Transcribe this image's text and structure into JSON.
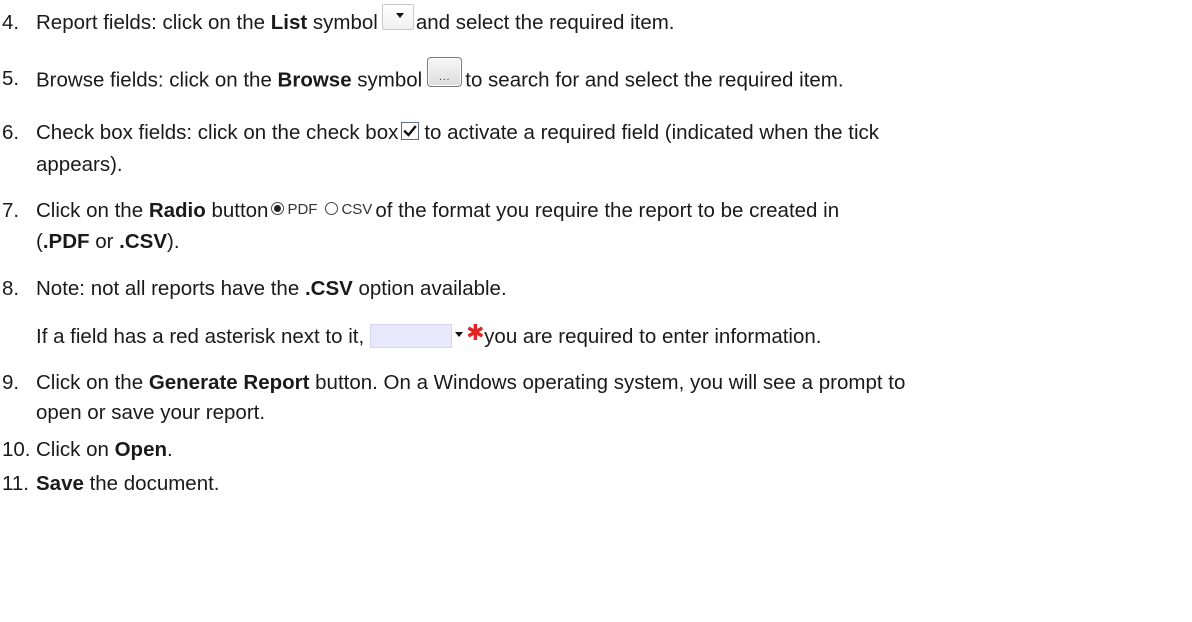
{
  "steps": {
    "s4": {
      "num": "4.",
      "pre": "Report fields: click on the ",
      "bold": "List",
      "mid": " symbol",
      "post": "and select the required item."
    },
    "s5": {
      "num": "5.",
      "pre": "Browse fields: click on the ",
      "bold": "Browse",
      "mid": " symbol",
      "post": "to search for and select the required item.",
      "browse_dots": "..."
    },
    "s6": {
      "num": "6.",
      "pre": "Check box fields: click on the check box",
      "post": "to activate a required field (indicated when the tick",
      "cont": "appears)."
    },
    "s7": {
      "num": "7.",
      "pre": "Click on the ",
      "bold": "Radio",
      "mid": " button",
      "radio_pdf": "PDF",
      "radio_csv": "CSV",
      "post": "of the format you require the report to be created in",
      "cont_open": "(",
      "cont_b1": ".PDF",
      "cont_or": " or ",
      "cont_b2": ".CSV",
      "cont_close": ")."
    },
    "s8": {
      "num": "8.",
      "pre": "Note: not all reports have the ",
      "bold": ".CSV",
      "post": " option available.",
      "line2_pre": "If a field has a red asterisk next to it,",
      "asterisk": "✱",
      "line2_post": "you are required to enter information."
    },
    "s9": {
      "num": "9.",
      "pre": "Click on the ",
      "bold": "Generate Report",
      "post": " button. On a Windows operating system, you will see a prompt to",
      "cont": "open or save your report."
    },
    "s10": {
      "num": "10.",
      "pre": "Click on ",
      "bold": "Open",
      "post": "."
    },
    "s11": {
      "num": "11.",
      "bold": "Save",
      "post": " the document."
    }
  },
  "colors": {
    "text": "#1a1a1a",
    "asterisk": "#e52222",
    "required_field": "#e8e8fc"
  }
}
